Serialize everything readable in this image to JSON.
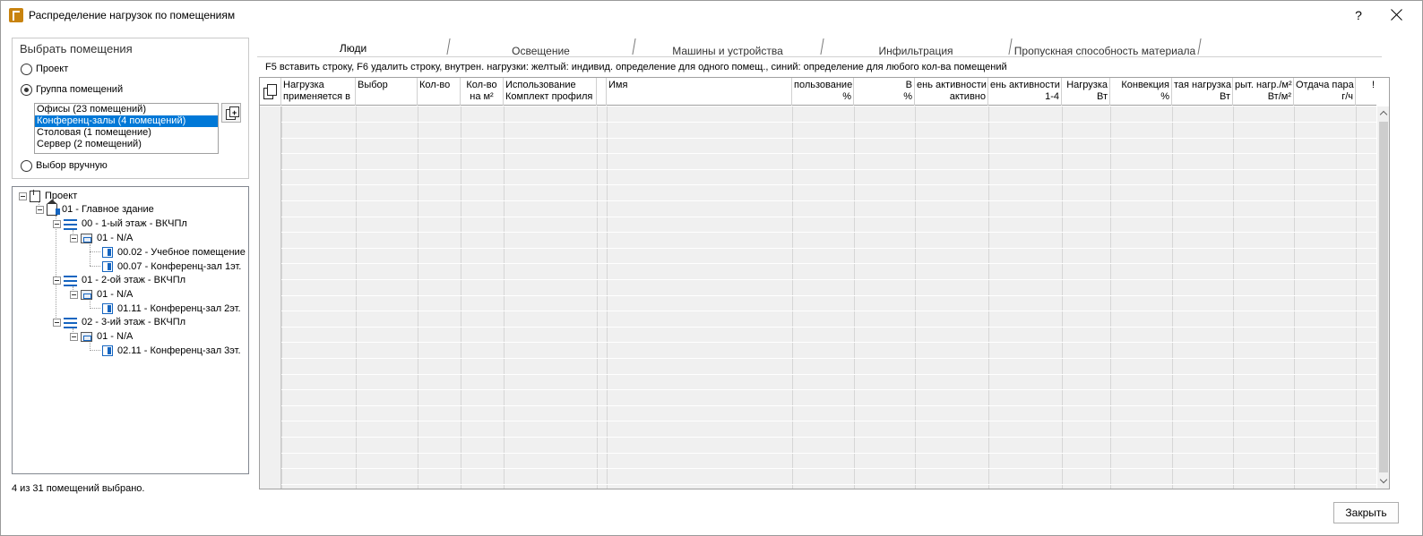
{
  "window": {
    "title": "Распределение нагрузок по помещениям",
    "help_label": "?"
  },
  "selection": {
    "title": "Выбрать помещения",
    "options": {
      "project": "Проект",
      "group": "Группа помещений",
      "manual": "Выбор вручную"
    },
    "selected_option": "group",
    "groups": [
      "Офисы (23 помещений)",
      "Конференц-залы (4 помещений)",
      "Столовая (1 помещение)",
      "Сервер (2 помещений)"
    ],
    "selected_group_index": 1
  },
  "tree": {
    "nodes": [
      {
        "label": "Проект",
        "type": "project"
      },
      {
        "label": "01 - Главное здание",
        "type": "building"
      },
      {
        "label": "00 - 1-ый этаж - ВКЧПл",
        "type": "floor"
      },
      {
        "label": "01 - N/A",
        "type": "zone"
      },
      {
        "label": "00.02 - Учебное помещение",
        "type": "room"
      },
      {
        "label": "00.07 - Конференц-зал 1эт.",
        "type": "room"
      },
      {
        "label": "01 - 2-ой этаж - ВКЧПл",
        "type": "floor"
      },
      {
        "label": "01 - N/A",
        "type": "zone"
      },
      {
        "label": "01.11 - Конференц-зал 2эт.",
        "type": "room"
      },
      {
        "label": "02 - 3-ий этаж - ВКЧПл",
        "type": "floor"
      },
      {
        "label": "01 - N/A",
        "type": "zone"
      },
      {
        "label": "02.11 - Конференц-зал 3эт.",
        "type": "room"
      }
    ]
  },
  "status": "4 из 31 помещений выбрано.",
  "tabs": [
    {
      "label": "Люди",
      "active": true
    },
    {
      "label": "Освещение",
      "active": false
    },
    {
      "label": "Машины и устройства",
      "active": false
    },
    {
      "label": "Инфильтрация",
      "active": false
    },
    {
      "label": "Пропускная способность материала",
      "active": false
    }
  ],
  "hint": "F5 вставить строку, F6 удалить строку, внутрен. нагрузки: желтый: индивид. определение для одного помещ., синий: определение для любого кол-ва помещений",
  "grid": {
    "columns": [
      {
        "line1": "Нагрузка",
        "line2": "применяется в"
      },
      {
        "line1": "Выбор",
        "line2": ""
      },
      {
        "line1": "Кол-во",
        "line2": ""
      },
      {
        "line1": "Кол-во",
        "line2": "на м²"
      },
      {
        "line1": "Использование",
        "line2": "Комплект профиля"
      },
      {
        "line1": "",
        "line2": ""
      },
      {
        "line1": "Имя",
        "line2": ""
      },
      {
        "line1": "пользование",
        "line2": "%"
      },
      {
        "line1": "В",
        "line2": "%"
      },
      {
        "line1": "ень активности",
        "line2": "активно"
      },
      {
        "line1": "ень активности",
        "line2": "1-4"
      },
      {
        "line1": "Нагрузка",
        "line2": "Вт"
      },
      {
        "line1": "Конвекция",
        "line2": "%"
      },
      {
        "line1": "тая нагрузка",
        "line2": "Вт"
      },
      {
        "line1": "рыт. нагр./м²",
        "line2": "Вт/м²"
      },
      {
        "line1": "Отдача пара",
        "line2": "г/ч"
      },
      {
        "line1": "!",
        "line2": ""
      }
    ],
    "rows": []
  },
  "buttons": {
    "close": "Закрыть"
  }
}
